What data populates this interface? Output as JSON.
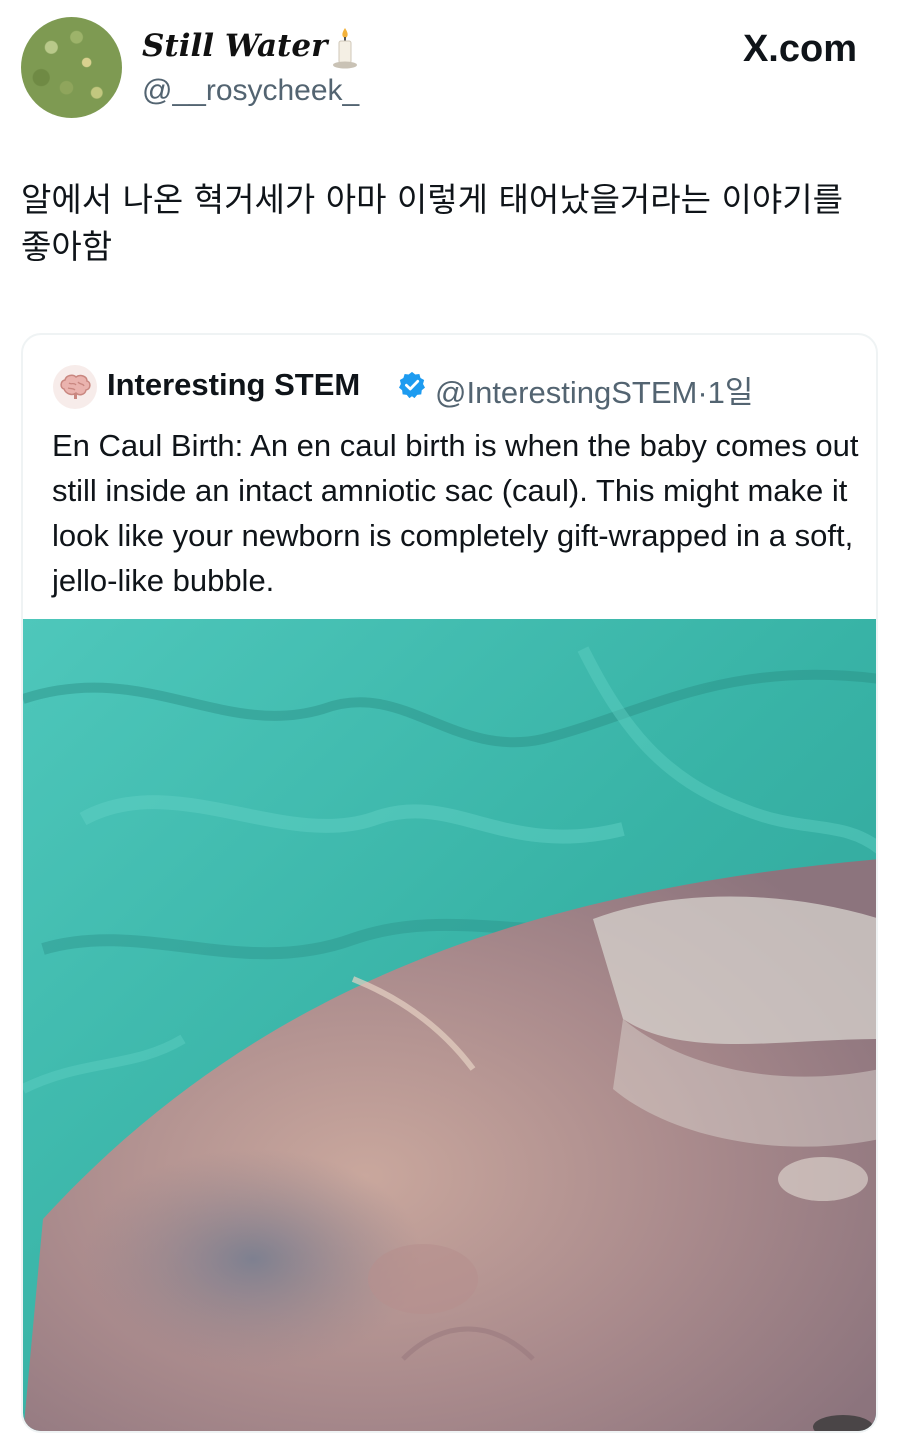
{
  "author": {
    "display_name": "Still Water",
    "handle": "@__rosycheek_",
    "avatar_icon": "painting-avatar",
    "name_emoji_icon": "candle-icon"
  },
  "brand": "X.com",
  "tweet_text": "알에서 나온 혁거세가 아마 이렇게 태어났을거라는 이야기를 좋아함",
  "quote": {
    "display_name": "Interesting STEM",
    "verified_icon": "verified-badge-icon",
    "handle": "@InterestingSTEM",
    "separator": "·",
    "time": "1일",
    "text": "En Caul Birth: An en caul birth is when the baby comes out still inside an intact amniotic sac (caul). This might make it look like your newborn is completely gift-wrapped in a soft, jello-like bubble.",
    "media_icon": "newborn-photo"
  },
  "colors": {
    "text": "#0f1419",
    "secondary": "#536471",
    "verified": "#1d9bf0",
    "border": "#eff3f4",
    "sheet": "#3fbdb0"
  }
}
